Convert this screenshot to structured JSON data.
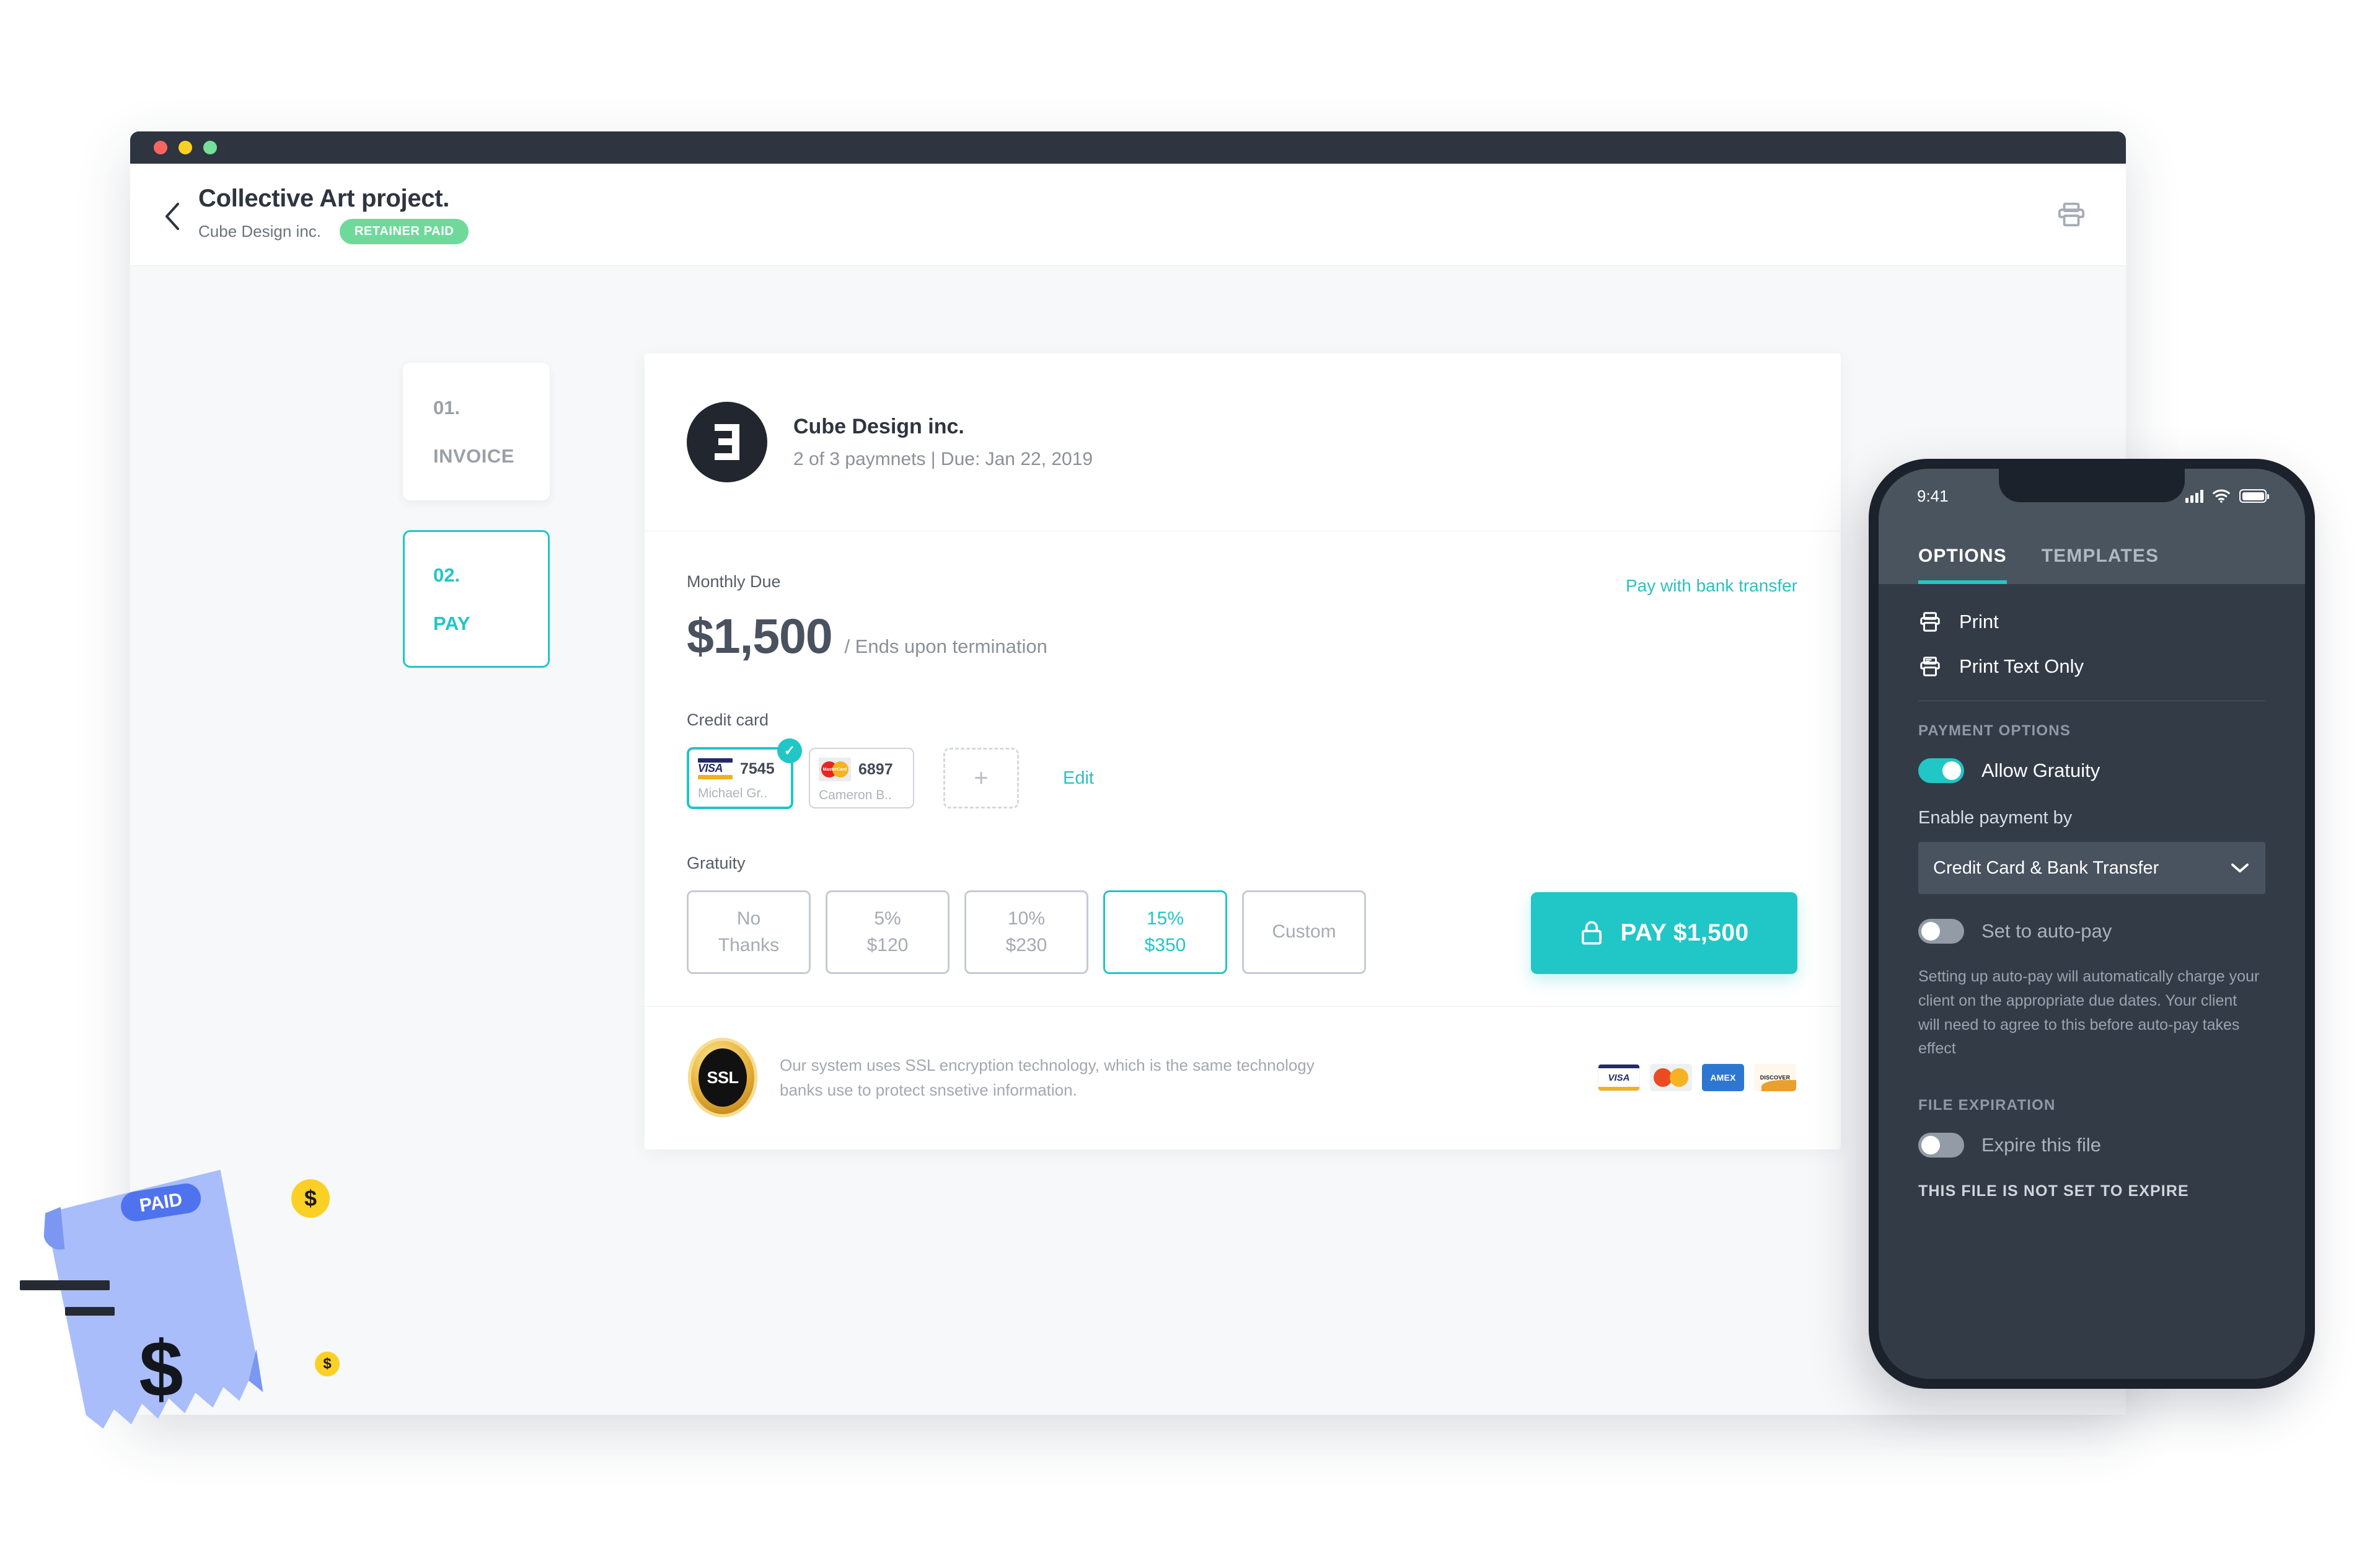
{
  "window": {
    "traffic_lights": [
      "close",
      "minimize",
      "maximize"
    ]
  },
  "header": {
    "back_icon": "chevron-left-icon",
    "project_title": "Collective Art project.",
    "client_name": "Cube Design inc.",
    "status_badge": "RETAINER PAID",
    "print_icon": "printer-icon"
  },
  "steps": [
    {
      "number": "01.",
      "label": "INVOICE",
      "active": false
    },
    {
      "number": "02.",
      "label": "PAY",
      "active": true
    }
  ],
  "invoice": {
    "brand_name": "Cube Design inc.",
    "brand_logo_icon": "cube-design-logo-icon",
    "meta": "2 of 3 paymnets | Due: Jan 22, 2019",
    "due_label": "Monthly Due",
    "amount": "$1,500",
    "amount_suffix": "/ Ends upon termination",
    "bank_transfer_link": "Pay with bank transfer",
    "credit_card_label": "Credit card",
    "cards": [
      {
        "brand": "VISA",
        "digits": "7545",
        "owner": "Michael Gr..",
        "selected": true
      },
      {
        "brand": "MasterCard",
        "digits": "6897",
        "owner": "Cameron B..",
        "selected": false
      }
    ],
    "add_card_icon": "plus-icon",
    "edit_link": "Edit",
    "gratuity_label": "Gratuity",
    "tips": [
      {
        "line1": "No",
        "line2": "Thanks",
        "selected": false
      },
      {
        "line1": "5%",
        "line2": "$120",
        "selected": false
      },
      {
        "line1": "10%",
        "line2": "$230",
        "selected": false
      },
      {
        "line1": "15%",
        "line2": "$350",
        "selected": true
      },
      {
        "line1": "Custom",
        "line2": "",
        "selected": false
      }
    ],
    "pay_button": {
      "icon": "lock-icon",
      "label": "PAY $1,500"
    },
    "footer": {
      "seal_text": "SSL",
      "seal_icon": "ssl-seal-icon",
      "disclaimer": "Our system uses SSL encryption technology, which is the same technology banks use to protect snsetive information.",
      "brand_marks": [
        "VISA",
        "MasterCard",
        "AMEX",
        "DISCOVER"
      ]
    }
  },
  "phone": {
    "status": {
      "time": "9:41",
      "signal_icon": "signal-icon",
      "wifi_icon": "wifi-icon",
      "battery_icon": "battery-icon"
    },
    "tabs": [
      {
        "label": "OPTIONS",
        "active": true
      },
      {
        "label": "TEMPLATES",
        "active": false
      }
    ],
    "actions": [
      {
        "icon": "printer-icon",
        "label": "Print"
      },
      {
        "icon": "printer-text-icon",
        "label": "Print Text Only"
      }
    ],
    "payment_options": {
      "section_title": "PAYMENT OPTIONS",
      "allow_gratuity": {
        "label": "Allow Gratuity",
        "on": true
      },
      "enable_payment_label": "Enable payment by",
      "payment_method": {
        "value": "Credit Card & Bank Transfer",
        "chevron_icon": "chevron-down-icon"
      },
      "auto_pay": {
        "label": "Set to auto-pay",
        "on": false
      },
      "auto_pay_helper": "Setting up auto-pay will automatically charge your client on the appropriate due dates. Your client will need to agree to this before auto-pay takes effect"
    },
    "file_expiration": {
      "section_title": "FILE EXPIRATION",
      "expire_file": {
        "label": "Expire this file",
        "on": false
      },
      "footer_note": "THIS FILE IS NOT SET TO EXPIRE"
    }
  },
  "decoration": {
    "receipt_badge": "PAID",
    "receipt_icon": "paid-receipt-icon",
    "coin_symbol": "$",
    "receipt_symbol": "$"
  },
  "colors": {
    "accent_teal": "#21c6c7",
    "badge_green": "#6fd99b",
    "dark": "#2e3440",
    "phone_body": "#1c222b",
    "phone_screen": "#333b47",
    "coin_yellow": "#fbd024",
    "receipt_blue": "#a8bdfa"
  }
}
